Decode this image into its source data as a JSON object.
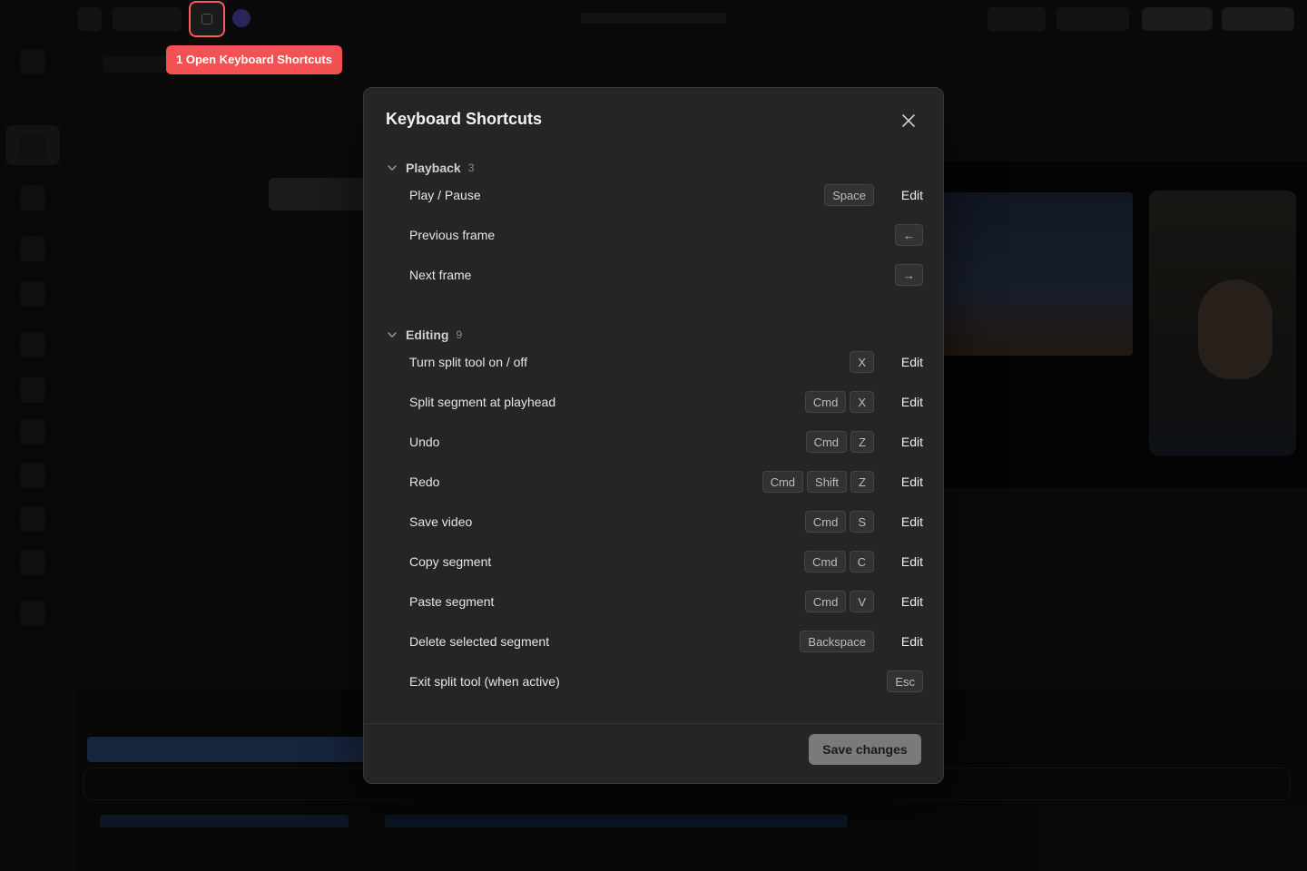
{
  "callout": {
    "label": "1 Open Keyboard Shortcuts",
    "color": "#f25252"
  },
  "modal": {
    "title": "Keyboard Shortcuts",
    "edit_label": "Edit",
    "save_label": "Save changes",
    "sections": [
      {
        "label": "Playback",
        "count": "3",
        "rows": [
          {
            "label": "Play / Pause",
            "keys": [
              "Space"
            ],
            "editable": true
          },
          {
            "label": "Previous frame",
            "keys": [
              "←"
            ],
            "editable": false
          },
          {
            "label": "Next frame",
            "keys": [
              "→"
            ],
            "editable": false
          }
        ]
      },
      {
        "label": "Editing",
        "count": "9",
        "rows": [
          {
            "label": "Turn split tool on / off",
            "keys": [
              "X"
            ],
            "editable": true
          },
          {
            "label": "Split segment at playhead",
            "keys": [
              "Cmd",
              "X"
            ],
            "editable": true
          },
          {
            "label": "Undo",
            "keys": [
              "Cmd",
              "Z"
            ],
            "editable": true
          },
          {
            "label": "Redo",
            "keys": [
              "Cmd",
              "Shift",
              "Z"
            ],
            "editable": true
          },
          {
            "label": "Save video",
            "keys": [
              "Cmd",
              "S"
            ],
            "editable": true
          },
          {
            "label": "Copy segment",
            "keys": [
              "Cmd",
              "C"
            ],
            "editable": true
          },
          {
            "label": "Paste segment",
            "keys": [
              "Cmd",
              "V"
            ],
            "editable": true
          },
          {
            "label": "Delete selected segment",
            "keys": [
              "Backspace"
            ],
            "editable": true
          },
          {
            "label": "Exit split tool (when active)",
            "keys": [
              "Esc"
            ],
            "editable": false
          }
        ]
      }
    ]
  }
}
